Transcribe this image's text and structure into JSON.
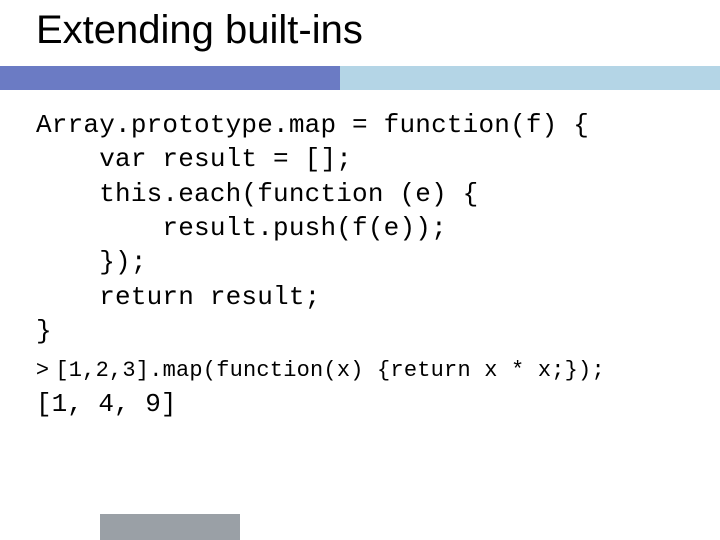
{
  "title": "Extending built-ins",
  "code": "Array.prototype.map = function(f) {\n    var result = [];\n    this.each(function (e) {\n        result.push(f(e));\n    });\n    return result;\n}",
  "repl_prompt": ">",
  "repl_input": "[1,2,3].map(function(x) {return x * x;});",
  "repl_output": "[1, 4, 9]"
}
